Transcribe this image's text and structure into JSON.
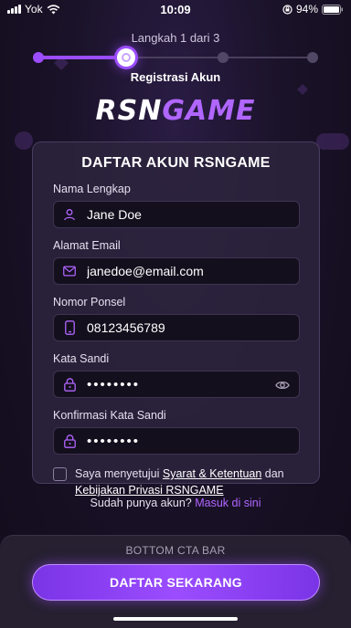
{
  "status_bar": {
    "carrier": "Yok",
    "time": "10:09",
    "battery": "94%"
  },
  "stepper": {
    "label": "Langkah 1 dari 3",
    "title": "Registrasi Akun",
    "current_step": 1,
    "total_steps": 3
  },
  "logo": {
    "part1": "RSN",
    "part2": "GAME"
  },
  "form": {
    "title": "DAFTAR AKUN RSNGAME",
    "fields": {
      "name": {
        "label": "Nama Lengkap",
        "value": "Jane Doe",
        "icon": "user-icon"
      },
      "email": {
        "label": "Alamat Email",
        "value": "janedoe@email.com",
        "icon": "mail-icon"
      },
      "phone": {
        "label": "Nomor Ponsel",
        "value": "08123456789",
        "icon": "phone-icon"
      },
      "password": {
        "label": "Kata Sandi",
        "value": "••••••••",
        "icon": "lock-icon"
      },
      "confirm_password": {
        "label": "Konfirmasi Kata Sandi",
        "value": "••••••••",
        "icon": "lock-icon"
      }
    },
    "agreement": {
      "prefix": "Saya menyetujui ",
      "terms_link": "Syarat & Ketentuan",
      "middle": " dan ",
      "privacy_link": "Kebijakan Privasi RSNGAME",
      "checked": false
    }
  },
  "login": {
    "prompt": "Sudah punya akun? ",
    "link": "Masuk di sini"
  },
  "bottom_bar": {
    "label": "BOTTOM CTA BAR",
    "cta": "DAFTAR SEKARANG"
  },
  "colors": {
    "accent": "#9b4dff",
    "accent_light": "#b066ff",
    "background": "#1a1228",
    "card": "#2d243e",
    "field": "#140f1d"
  }
}
